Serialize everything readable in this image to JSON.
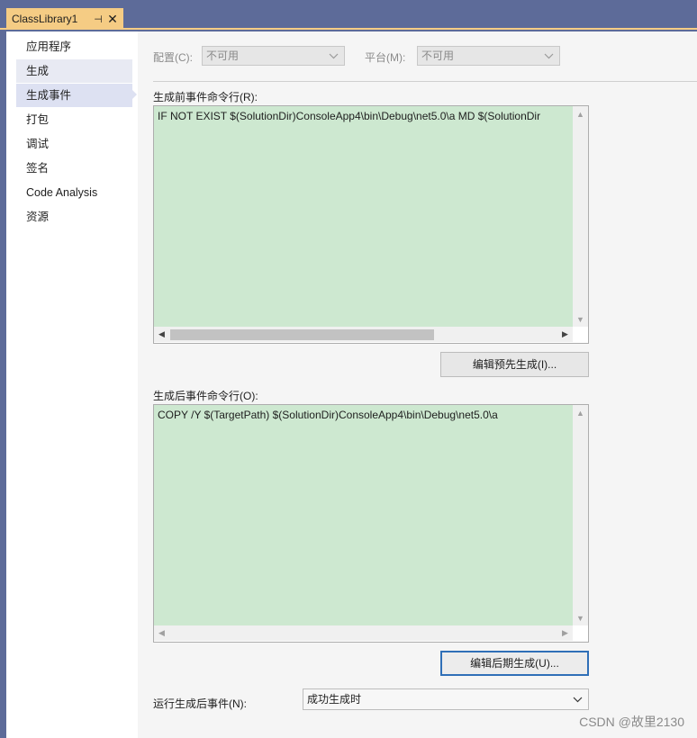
{
  "window": {
    "tab_title": "ClassLibrary1",
    "pin_glyph": "⊣",
    "close_glyph": "✕"
  },
  "sidebar": {
    "items": [
      {
        "label": "应用程序",
        "state": "normal"
      },
      {
        "label": "生成",
        "state": "hover"
      },
      {
        "label": "生成事件",
        "state": "selected"
      },
      {
        "label": "打包",
        "state": "normal"
      },
      {
        "label": "调试",
        "state": "normal"
      },
      {
        "label": "签名",
        "state": "normal"
      },
      {
        "label": "Code Analysis",
        "state": "normal"
      },
      {
        "label": "资源",
        "state": "normal"
      }
    ]
  },
  "config": {
    "config_label": "配置(C):",
    "config_value": "不可用",
    "platform_label": "平台(M):",
    "platform_value": "不可用"
  },
  "prebuild": {
    "label": "生成前事件命令行(R):",
    "command": "IF  NOT EXIST $(SolutionDir)ConsoleApp4\\bin\\Debug\\net5.0\\a MD $(SolutionDir",
    "edit_button": "编辑预先生成(I)..."
  },
  "postbuild": {
    "label": "生成后事件命令行(O):",
    "command": "COPY /Y $(TargetPath) $(SolutionDir)ConsoleApp4\\bin\\Debug\\net5.0\\a",
    "edit_button": "编辑后期生成(U)..."
  },
  "run_event": {
    "label": "运行生成后事件(N):",
    "value": "成功生成时"
  },
  "watermark": "CSDN @故里2130",
  "colors": {
    "title_bar": "#5d6b99",
    "active_tab": "#f5cc84",
    "editor_background": "#cde8d0",
    "focus_border": "#2f6fb7"
  }
}
